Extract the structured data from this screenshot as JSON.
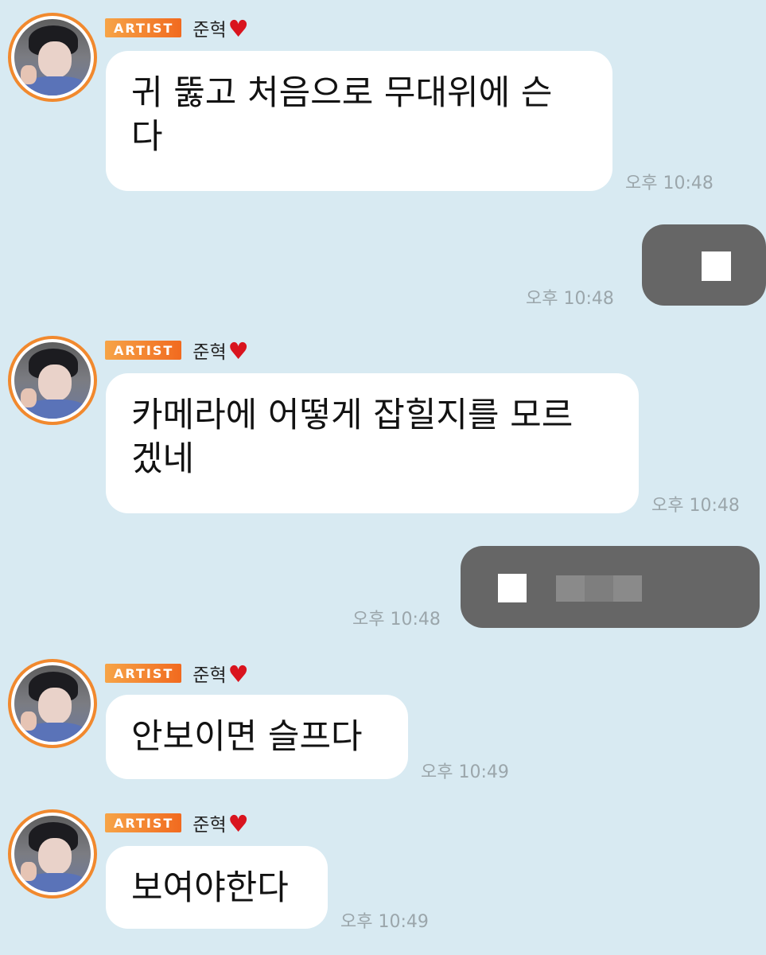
{
  "chat": {
    "messages": [
      {
        "type": "artist",
        "badge": "ARTIST",
        "name": "준혁",
        "heart": "♥",
        "text": "귀 뚫고 처음으로 무대위에 슨\n다",
        "time": "오후 10:48"
      },
      {
        "type": "self",
        "time": "오후 10:48"
      },
      {
        "type": "artist",
        "badge": "ARTIST",
        "name": "준혁",
        "heart": "♥",
        "text": "카메라에 어떻게 잡힐지를 모르\n겠네",
        "time": "오후 10:48"
      },
      {
        "type": "self",
        "time": "오후 10:48"
      },
      {
        "type": "artist",
        "badge": "ARTIST",
        "name": "준혁",
        "heart": "♥",
        "text": "안보이면 슬프다",
        "time": "오후 10:49"
      },
      {
        "type": "artist",
        "badge": "ARTIST",
        "name": "준혁",
        "heart": "♥",
        "text": "보여야한다",
        "time": "오후 10:49"
      }
    ]
  },
  "colors": {
    "background": "#d8eaf2",
    "bubble": "#ffffff",
    "self_bubble_redacted": "#666666",
    "badge_start": "#f6a447",
    "badge_end": "#f16a1f",
    "time": "#9ba6ab"
  }
}
